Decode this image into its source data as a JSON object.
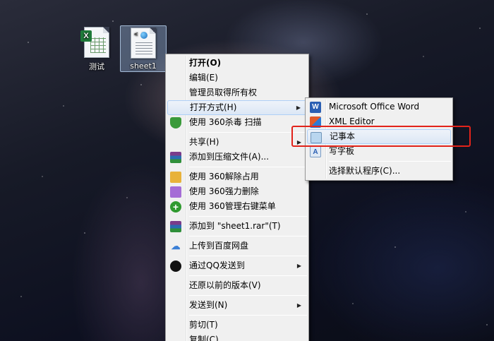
{
  "desktop": {
    "icons": [
      {
        "label": "测试",
        "badge": "X"
      },
      {
        "label": "sheet1",
        "glyph": "<  >"
      }
    ]
  },
  "context_menu": {
    "items": [
      {
        "label": "打开(O)",
        "bold": true
      },
      {
        "label": "编辑(E)"
      },
      {
        "label": "管理员取得所有权"
      },
      {
        "label": "打开方式(H)",
        "submenu": true,
        "highlighted": true
      },
      {
        "label": "使用 360杀毒 扫描",
        "icon": "shield-icon"
      },
      {
        "label": "共享(H)",
        "submenu": true
      },
      {
        "label": "添加到压缩文件(A)...",
        "icon": "archive-icon"
      },
      {
        "label": "使用 360解除占用",
        "icon": "folder-unlock-icon"
      },
      {
        "label": "使用 360强力删除",
        "icon": "shred-icon"
      },
      {
        "label": "使用 360管理右键菜单",
        "icon": "plus-icon"
      },
      {
        "label": "添加到 \"sheet1.rar\"(T)",
        "icon": "archive-icon"
      },
      {
        "label": "上传到百度网盘",
        "icon": "cloud-icon"
      },
      {
        "label": "通过QQ发送到",
        "icon": "qq-penguin-icon",
        "submenu": true
      },
      {
        "label": "还原以前的版本(V)"
      },
      {
        "label": "发送到(N)",
        "submenu": true
      },
      {
        "label": "剪切(T)"
      },
      {
        "label": "复制(C)"
      }
    ],
    "arrow_glyph": "▶"
  },
  "open_with_menu": {
    "items": [
      {
        "label": "Microsoft Office Word",
        "icon": "word-icon",
        "glyph": "W"
      },
      {
        "label": "XML Editor",
        "icon": "xml-editor-icon",
        "glyph": ""
      },
      {
        "label": "记事本",
        "icon": "notepad-icon",
        "glyph": "",
        "highlighted": true
      },
      {
        "label": "写字板",
        "icon": "wordpad-icon",
        "glyph": "A"
      },
      {
        "label": "选择默认程序(C)..."
      }
    ]
  },
  "colors": {
    "highlight_border": "#e2231a",
    "menu_bg": "#f0f0f0"
  }
}
